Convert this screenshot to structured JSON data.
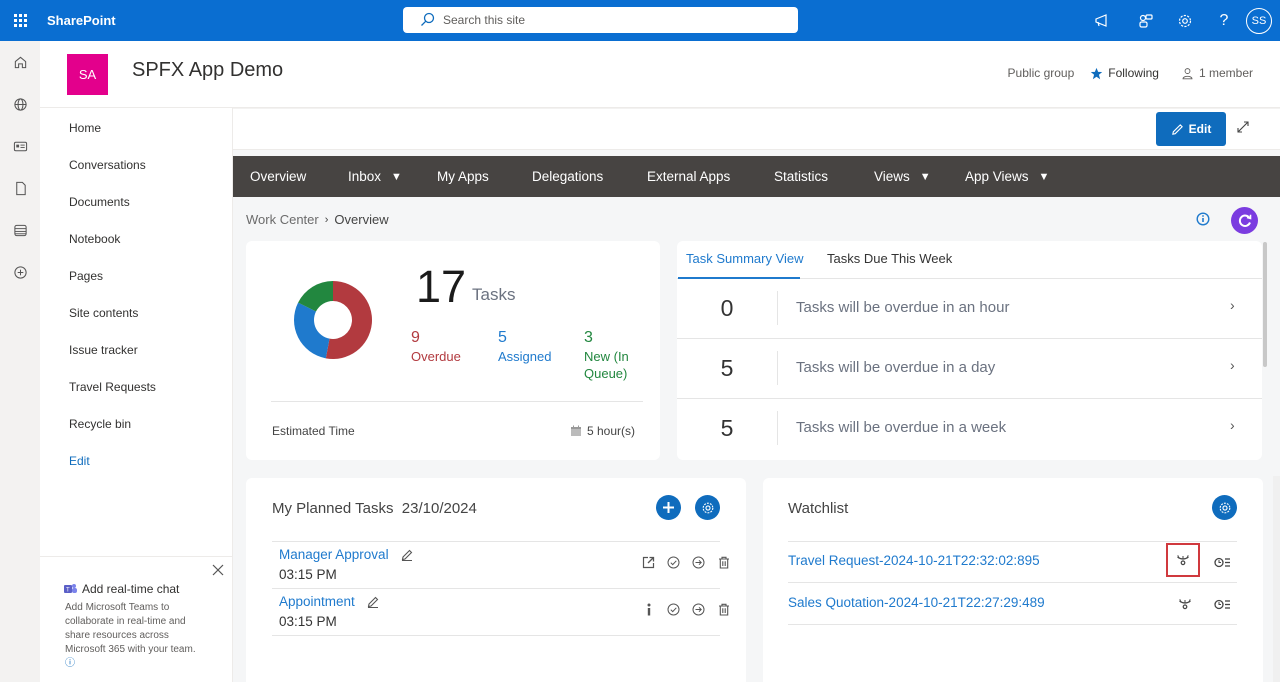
{
  "suitebar": {
    "app_name": "SharePoint",
    "search_placeholder": "Search this site",
    "icons": [
      "megaphone-icon",
      "teams-switch-icon",
      "settings-gear-icon",
      "help-icon"
    ],
    "user_initials": "SS"
  },
  "site": {
    "logo_initials": "SA",
    "title": "SPFX App Demo",
    "group_type": "Public group",
    "following_label": "Following",
    "members_label": "1 member",
    "brand_color": "#e3008c"
  },
  "leftnav": {
    "items": [
      {
        "label": "Home"
      },
      {
        "label": "Conversations"
      },
      {
        "label": "Documents"
      },
      {
        "label": "Notebook"
      },
      {
        "label": "Pages"
      },
      {
        "label": "Site contents"
      },
      {
        "label": "Issue tracker"
      },
      {
        "label": "Travel Requests"
      },
      {
        "label": "Recycle bin"
      }
    ],
    "edit_label": "Edit"
  },
  "chat_promo": {
    "title": "Add real-time chat",
    "description": "Add Microsoft Teams to collaborate in real-time and share resources across Microsoft 365 with your team."
  },
  "commandbar": {
    "edit_label": "Edit"
  },
  "topnav": {
    "items": [
      {
        "label": "Overview",
        "dropdown": false
      },
      {
        "label": "Inbox",
        "dropdown": true
      },
      {
        "label": "My Apps",
        "dropdown": false
      },
      {
        "label": "Delegations",
        "dropdown": false
      },
      {
        "label": "External Apps",
        "dropdown": false
      },
      {
        "label": "Statistics",
        "dropdown": false
      },
      {
        "label": "Views",
        "dropdown": true
      },
      {
        "label": "App Views",
        "dropdown": true
      }
    ],
    "caret": "▼"
  },
  "breadcrumb": {
    "parent": "Work Center",
    "separator": "›",
    "current": "Overview"
  },
  "summary": {
    "total": "17",
    "total_label": "Tasks",
    "stats": [
      {
        "value": 9,
        "label": "Overdue",
        "color": "#b23a3f"
      },
      {
        "value": 5,
        "label": "Assigned",
        "color": "#1f7acd"
      },
      {
        "value": 3,
        "label": "New (In Queue)",
        "color": "#22873f"
      }
    ],
    "estimated_label": "Estimated Time",
    "estimated_value": "5 hour(s)"
  },
  "task_summary": {
    "tabs": [
      {
        "label": "Task Summary View",
        "active": true
      },
      {
        "label": "Tasks Due This Week",
        "active": false
      }
    ],
    "rows": [
      {
        "count": "0",
        "text": "Tasks will be overdue in an hour"
      },
      {
        "count": "5",
        "text": "Tasks will be overdue in a day"
      },
      {
        "count": "5",
        "text": "Tasks will be overdue in a week"
      }
    ],
    "chevron": "›"
  },
  "planned_tasks": {
    "title": "My Planned Tasks",
    "date": "23/10/2024",
    "items": [
      {
        "name": "Manager Approval",
        "time": "03:15 PM",
        "first_action": "open-external-icon"
      },
      {
        "name": "Appointment",
        "time": "03:15 PM",
        "first_action": "info-icon"
      }
    ]
  },
  "watchlist": {
    "title": "Watchlist",
    "items": [
      {
        "name": "Travel Request-2024-10-21T22:32:02:895",
        "highlighted": true
      },
      {
        "name": "Sales Quotation-2024-10-21T22:27:29:489",
        "highlighted": false
      }
    ]
  }
}
